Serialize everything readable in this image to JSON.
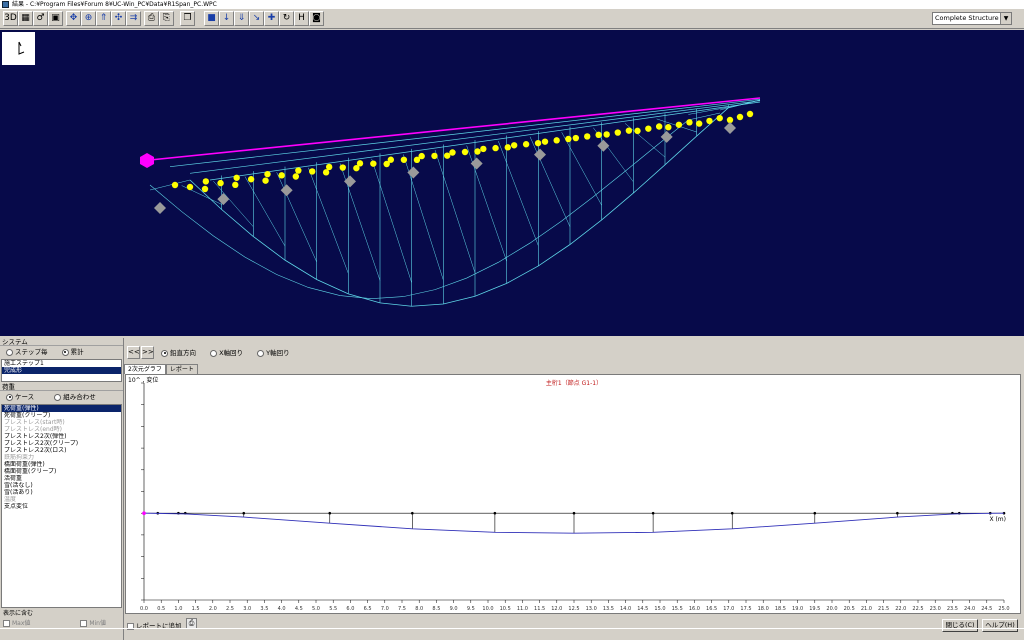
{
  "window": {
    "title": "結果 - C:¥Program Files¥Forum 8¥UC-Win_PC¥Data¥R1Span_PC.WPC"
  },
  "toolbar": {
    "buttons": [
      {
        "name": "view-3d-button",
        "glyph": "3D"
      },
      {
        "name": "section-view-button",
        "glyph": "▦"
      },
      {
        "name": "pointer-button",
        "glyph": "♂"
      },
      {
        "name": "member-button",
        "glyph": "▣"
      },
      {
        "name": "rotate-button",
        "glyph": "✥"
      },
      {
        "name": "zoom-fit-button",
        "glyph": "⊕"
      },
      {
        "name": "pan-up-button",
        "glyph": "⇑"
      },
      {
        "name": "move-button",
        "glyph": "✣"
      },
      {
        "name": "pan-right-button",
        "glyph": "⇉"
      },
      {
        "name": "print-view-button",
        "glyph": "⎙"
      },
      {
        "name": "copy-view-button",
        "glyph": "⎘"
      },
      {
        "name": "window-button",
        "glyph": "❐"
      },
      {
        "name": "fill-button",
        "glyph": "■"
      },
      {
        "name": "down-arrow-button",
        "glyph": "↓"
      },
      {
        "name": "load-arrow-button",
        "glyph": "⇓"
      },
      {
        "name": "diagonal-button",
        "glyph": "↘"
      },
      {
        "name": "cross-button",
        "glyph": "✚"
      },
      {
        "name": "cycle-button",
        "glyph": "↻"
      },
      {
        "name": "h-button",
        "glyph": "H"
      },
      {
        "name": "camera-button",
        "glyph": "◙"
      }
    ],
    "structure_select": "Complete Structure"
  },
  "colors": {
    "view_bg": "#070a4a",
    "yellow_node": "#ffff00",
    "gray_node": "#9a9a9a",
    "wire": "#5fd7e8",
    "girder": "#ff00ff",
    "graph_line": "#3030b8"
  },
  "left": {
    "system_label": "システム",
    "mode_options": [
      "ステップ毎",
      "累計"
    ],
    "mode_selected": 1,
    "steps": [
      "施工ステップ1",
      "完成形"
    ],
    "steps_selected": 1,
    "load_label": "荷重",
    "case_options": [
      "ケース",
      "組み合わせ"
    ],
    "case_selected": 0,
    "loads": [
      {
        "text": "死荷重(弾性)",
        "state": "sel"
      },
      {
        "text": "死荷重(クリープ)",
        "state": ""
      },
      {
        "text": "プレストレス(start時)",
        "state": "dim"
      },
      {
        "text": "プレストレス(end時)",
        "state": "dim"
      },
      {
        "text": "プレストレス2次(弾性)",
        "state": ""
      },
      {
        "text": "プレストレス2次(クリープ)",
        "state": ""
      },
      {
        "text": "プレストレス2次(ロス)",
        "state": ""
      },
      {
        "text": "鉄筋拘束力",
        "state": "dim"
      },
      {
        "text": "橋面荷重(弾性)",
        "state": ""
      },
      {
        "text": "橋面荷重(クリープ)",
        "state": ""
      },
      {
        "text": "活荷重",
        "state": ""
      },
      {
        "text": "雪(活なし)",
        "state": ""
      },
      {
        "text": "雪(活あり)",
        "state": ""
      },
      {
        "text": "温度",
        "state": "dim"
      },
      {
        "text": "支点変位",
        "state": ""
      }
    ],
    "display_label": "表示に含む",
    "max_label": "Max値",
    "min_label": "Min値"
  },
  "right": {
    "nav_prev": "<<",
    "nav_next": ">>",
    "direction_options": [
      "鉛直方向",
      "X軸回り",
      "Y軸回り"
    ],
    "direction_selected": 0,
    "tabs": [
      "2次元グラフ",
      "レポート"
    ],
    "active_tab": 0,
    "add_report": "レポートに追加",
    "close_button": "閉じる(C)",
    "help_button": "ヘルプ(H)"
  },
  "chart_data": {
    "type": "line",
    "title": "主桁1（節点 G1-1）",
    "ylabel": "10^ , 変位",
    "xlabel": "X (m)",
    "x_ticks": [
      "0.0",
      "0.5",
      "1.0",
      "1.5",
      "2.0",
      "2.5",
      "3.0",
      "3.5",
      "4.0",
      "4.5",
      "5.0",
      "5.5",
      "6.0",
      "6.5",
      "7.0",
      "7.5",
      "8.0",
      "8.5",
      "9.0",
      "9.5",
      "10.0",
      "10.5",
      "11.0",
      "11.5",
      "12.0",
      "12.5",
      "13.0",
      "13.5",
      "14.0",
      "14.5",
      "15.0",
      "15.5",
      "16.0",
      "16.5",
      "17.0",
      "17.5",
      "18.0",
      "18.5",
      "19.0",
      "19.5",
      "20.0",
      "20.5",
      "21.0",
      "21.5",
      "22.0",
      "22.5",
      "23.0",
      "23.5",
      "24.0",
      "24.5",
      "25.0"
    ],
    "nodes_x": [
      0.0,
      0.4,
      1.0,
      1.2,
      2.9,
      5.4,
      7.8,
      10.2,
      12.5,
      14.8,
      17.1,
      19.5,
      21.9,
      23.5,
      23.7,
      24.6,
      25.0
    ],
    "nodes_y": [
      0,
      -0.008,
      -0.03,
      -0.036,
      -0.18,
      -0.46,
      -0.72,
      -0.88,
      -0.92,
      -0.88,
      -0.72,
      -0.46,
      -0.18,
      -0.04,
      -0.03,
      -0.004,
      0
    ],
    "ylim": [
      -4,
      6
    ],
    "xlim": [
      0,
      25
    ]
  }
}
